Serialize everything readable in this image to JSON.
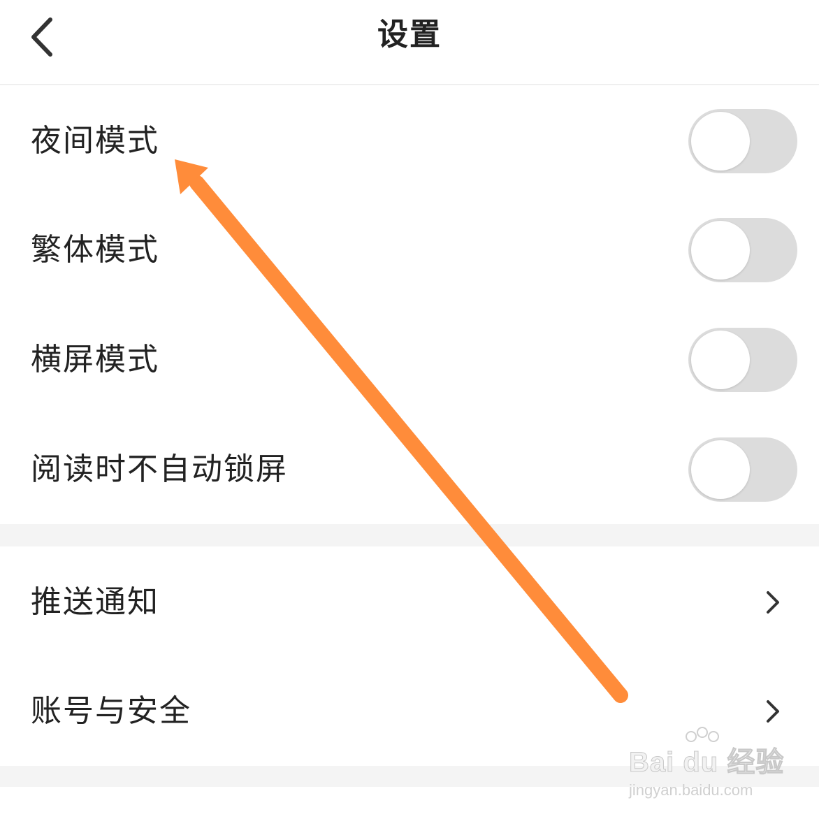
{
  "header": {
    "title": "设置",
    "back_icon": "chevron-left-icon"
  },
  "toggles": [
    {
      "label": "夜间模式",
      "on": false
    },
    {
      "label": "繁体模式",
      "on": false
    },
    {
      "label": "横屏模式",
      "on": false
    },
    {
      "label": "阅读时不自动锁屏",
      "on": false
    }
  ],
  "links": [
    {
      "label": "推送通知",
      "icon": "chevron-right-icon"
    },
    {
      "label": "账号与安全",
      "icon": "chevron-right-icon"
    }
  ],
  "annotation": {
    "arrow_color": "#FF8C3A",
    "points_to": "夜间模式"
  },
  "watermark": {
    "brand": "Bai du 经验",
    "url": "jingyan.baidu.com"
  },
  "colors": {
    "text": "#222222",
    "toggle_off": "#dcdcdc",
    "section_gap": "#f4f4f4"
  }
}
